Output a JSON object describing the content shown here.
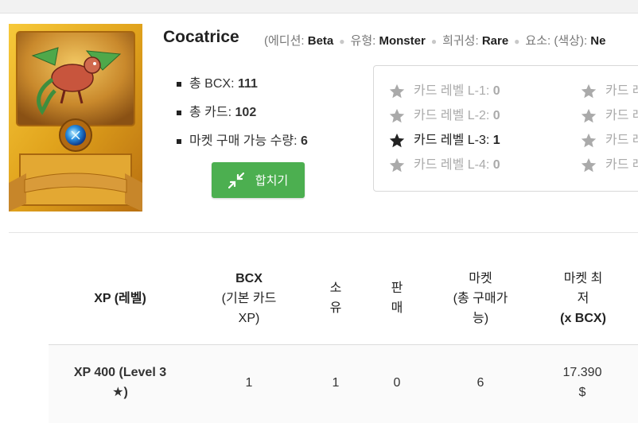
{
  "card": {
    "name": "Cocatrice",
    "edition_label": "(에디션:",
    "edition": "Beta",
    "type_label": "유형:",
    "type": "Monster",
    "rarity_label": "희귀성:",
    "rarity": "Rare",
    "element_label": "요소: (색상):",
    "element": "Ne"
  },
  "stats": [
    {
      "label": "총 BCX:",
      "value": "111"
    },
    {
      "label": "총 카드:",
      "value": "102"
    },
    {
      "label": "마켓 구매 가능 수량:",
      "value": "6"
    }
  ],
  "combine_button": {
    "label": "합치기",
    "icon": "compress-arrows-icon"
  },
  "levels": [
    {
      "label": "카드 레벨 L-1:",
      "value": "0",
      "active": false
    },
    {
      "label": "카드 레벨 L-2:",
      "value": "0",
      "active": false
    },
    {
      "label": "카드 레벨 L-3:",
      "value": "1",
      "active": true
    },
    {
      "label": "카드 레벨 L-4:",
      "value": "0",
      "active": false
    }
  ],
  "levels_col2": [
    "카드 레",
    "카드 레",
    "카드 레",
    "카드 레"
  ],
  "table": {
    "headers": {
      "xp": "XP (레벨)",
      "bcx_title": "BCX",
      "bcx_sub1": "(기본 카드",
      "bcx_sub2": "XP)",
      "own1": "소",
      "own2": "유",
      "sell1": "판",
      "sell2": "매",
      "market1": "마켓",
      "market2": "(총 구매가",
      "market3": "능)",
      "min1": "마켓 최",
      "min2": "저",
      "min3": "(x BCX)"
    },
    "row": {
      "xp_line1": "XP 400 (Level 3",
      "xp_line2": "★)",
      "bcx": "1",
      "own": "1",
      "sell": "0",
      "market": "6",
      "price_line1": "17.390",
      "price_line2": "$"
    }
  },
  "colors": {
    "accent_green": "#4caf50",
    "star_active": "#222222",
    "star_inactive": "#aaaaaa"
  }
}
